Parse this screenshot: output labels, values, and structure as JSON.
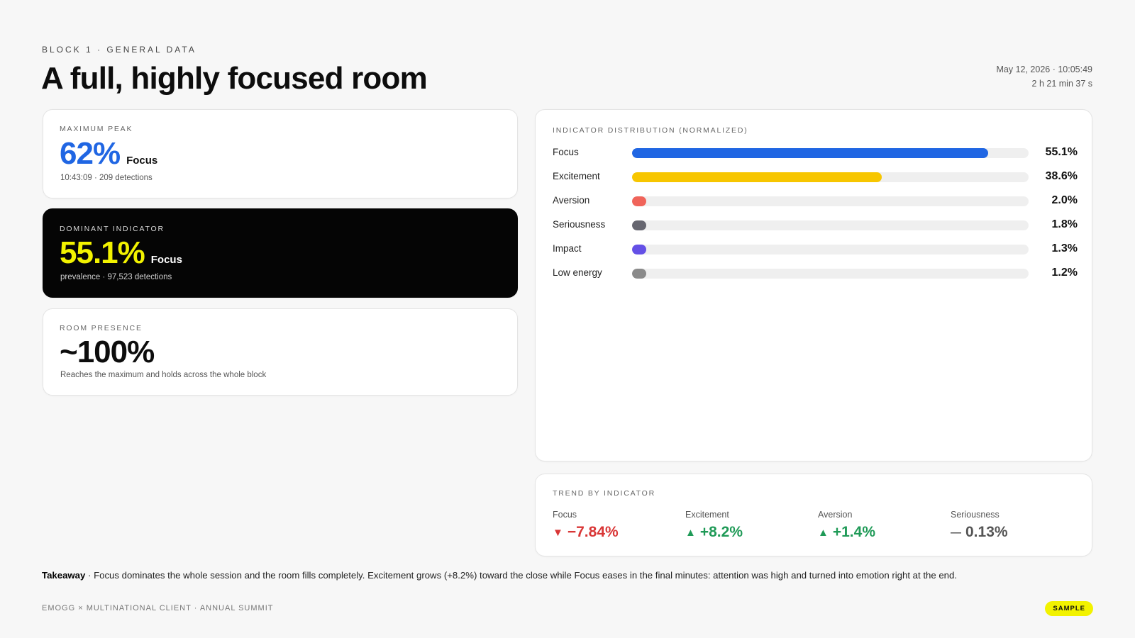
{
  "header": {
    "eyebrow": "BLOCK 1 · GENERAL DATA",
    "title": "A full, highly focused room",
    "datetime": "May 12, 2026 · 10:05:49",
    "duration": "2 h 21 min 37 s"
  },
  "peak": {
    "label": "MAXIMUM PEAK",
    "value": "62%",
    "indicator": "Focus",
    "detail": "10:43:09 · 209 detections"
  },
  "dominant": {
    "label": "DOMINANT INDICATOR",
    "value": "55.1%",
    "indicator": "Focus",
    "detail": "prevalence · 97,523 detections"
  },
  "presence": {
    "label": "ROOM PRESENCE",
    "value": "~100%",
    "detail": "Reaches the maximum and holds across the whole block"
  },
  "distribution": {
    "label": "INDICATOR DISTRIBUTION (NORMALIZED)",
    "items": [
      {
        "name": "Focus",
        "value": 55.1,
        "display": "55.1%",
        "color": "#2066e3"
      },
      {
        "name": "Excitement",
        "value": 38.6,
        "display": "38.6%",
        "color": "#f7c600"
      },
      {
        "name": "Aversion",
        "value": 2.0,
        "display": "2.0%",
        "color": "#f0645a"
      },
      {
        "name": "Seriousness",
        "value": 1.8,
        "display": "1.8%",
        "color": "#666670"
      },
      {
        "name": "Impact",
        "value": 1.3,
        "display": "1.3%",
        "color": "#6450e6"
      },
      {
        "name": "Low energy",
        "value": 1.2,
        "display": "1.2%",
        "color": "#8a8a8a"
      }
    ],
    "scale_max": 61.3
  },
  "trend": {
    "label": "TREND BY INDICATOR",
    "items": [
      {
        "name": "Focus",
        "value": "−7.84%",
        "direction": "down",
        "arrow": "▼"
      },
      {
        "name": "Excitement",
        "value": "+8.2%",
        "direction": "up",
        "arrow": "▲"
      },
      {
        "name": "Aversion",
        "value": "+1.4%",
        "direction": "up",
        "arrow": "▲"
      },
      {
        "name": "Seriousness",
        "value": "0.13%",
        "direction": "flat",
        "arrow": "—"
      }
    ]
  },
  "takeaway": {
    "lead": "Takeaway",
    "text": " · Focus dominates the whole session and the room fills completely. Excitement grows (+8.2%) toward the close while Focus eases in the final minutes: attention was high and turned into emotion right at the end."
  },
  "footer": {
    "text": "EMOGG × MULTINATIONAL CLIENT · ANNUAL SUMMIT",
    "badge": "SAMPLE"
  }
}
